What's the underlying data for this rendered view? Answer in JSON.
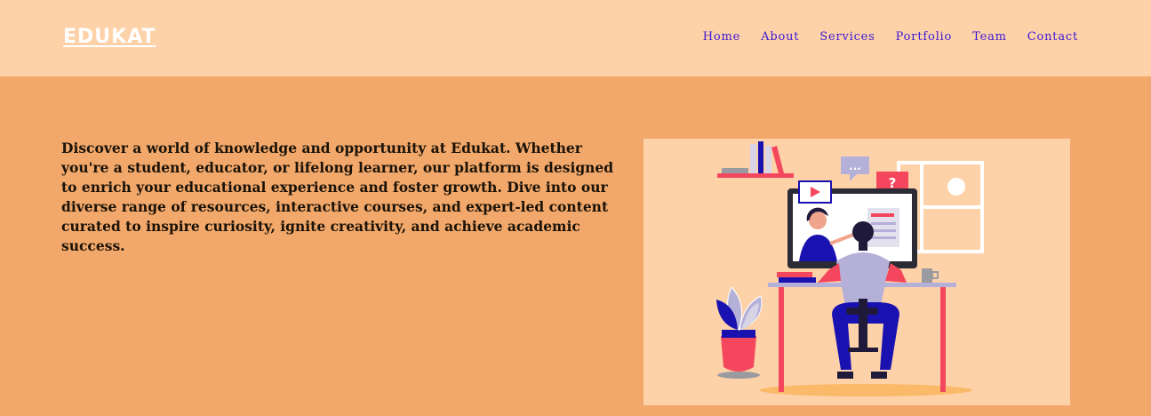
{
  "brand": {
    "name": "EDUKAT"
  },
  "nav": {
    "items": [
      {
        "label": "Home"
      },
      {
        "label": "About"
      },
      {
        "label": "Services"
      },
      {
        "label": "Portfolio"
      },
      {
        "label": "Team"
      },
      {
        "label": "Contact"
      }
    ]
  },
  "hero": {
    "text": "Discover a world of knowledge and opportunity at Edukat. Whether you're a student, educator, or lifelong learner, our platform is designed to enrich your educational experience and foster growth. Dive into our diverse range of resources, interactive courses, and expert-led content curated to inspire curiosity, ignite creativity, and achieve academic success.",
    "illustration": {
      "icon": "online-learning-illustration",
      "chat_bubble_text": "...",
      "question_bubble_text": "?"
    }
  },
  "colors": {
    "header_bg": "#fed2a8",
    "page_bg": "#f1a86a",
    "nav_link": "#3a18d6",
    "accent_red": "#f4475e",
    "accent_blue": "#1a12b0"
  }
}
